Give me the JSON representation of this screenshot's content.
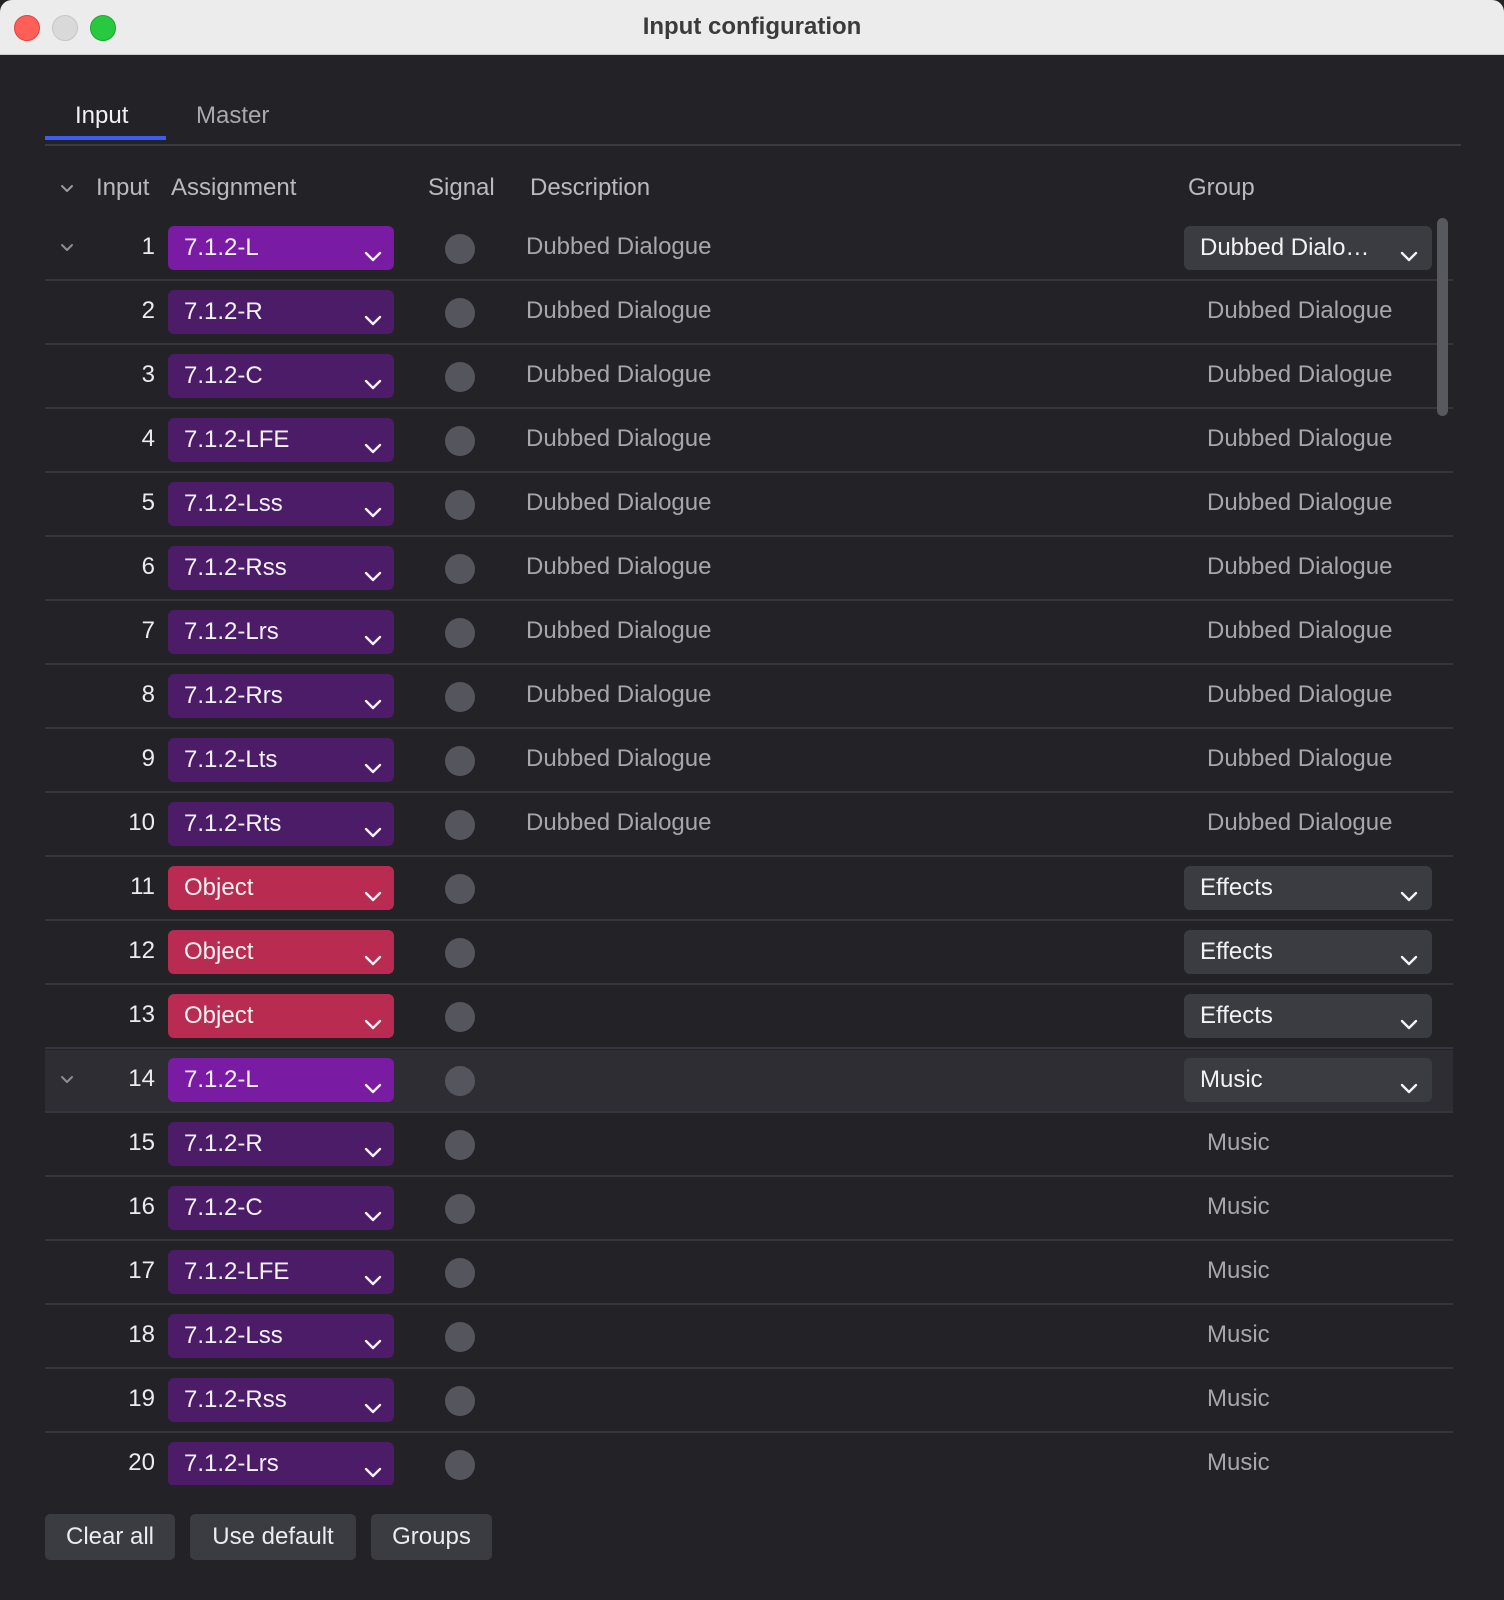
{
  "window": {
    "title": "Input configuration"
  },
  "tabs": {
    "items": [
      {
        "label": "Input",
        "active": true
      },
      {
        "label": "Master",
        "active": false
      }
    ]
  },
  "table": {
    "headers": {
      "input": "Input",
      "assignment": "Assignment",
      "signal": "Signal",
      "description": "Description",
      "group": "Group"
    },
    "rows": [
      {
        "input": "1",
        "assignment": "7.1.2-L",
        "assignment_kind": "bed-first",
        "description": "Dubbed Dialogue",
        "group": "Dubbed Dialo…",
        "group_is_select": true,
        "expandable": true
      },
      {
        "input": "2",
        "assignment": "7.1.2-R",
        "assignment_kind": "bed",
        "description": "Dubbed Dialogue",
        "group": "Dubbed Dialogue",
        "group_is_select": false
      },
      {
        "input": "3",
        "assignment": "7.1.2-C",
        "assignment_kind": "bed",
        "description": "Dubbed Dialogue",
        "group": "Dubbed Dialogue",
        "group_is_select": false
      },
      {
        "input": "4",
        "assignment": "7.1.2-LFE",
        "assignment_kind": "bed",
        "description": "Dubbed Dialogue",
        "group": "Dubbed Dialogue",
        "group_is_select": false
      },
      {
        "input": "5",
        "assignment": "7.1.2-Lss",
        "assignment_kind": "bed",
        "description": "Dubbed Dialogue",
        "group": "Dubbed Dialogue",
        "group_is_select": false
      },
      {
        "input": "6",
        "assignment": "7.1.2-Rss",
        "assignment_kind": "bed",
        "description": "Dubbed Dialogue",
        "group": "Dubbed Dialogue",
        "group_is_select": false
      },
      {
        "input": "7",
        "assignment": "7.1.2-Lrs",
        "assignment_kind": "bed",
        "description": "Dubbed Dialogue",
        "group": "Dubbed Dialogue",
        "group_is_select": false
      },
      {
        "input": "8",
        "assignment": "7.1.2-Rrs",
        "assignment_kind": "bed",
        "description": "Dubbed Dialogue",
        "group": "Dubbed Dialogue",
        "group_is_select": false
      },
      {
        "input": "9",
        "assignment": "7.1.2-Lts",
        "assignment_kind": "bed",
        "description": "Dubbed Dialogue",
        "group": "Dubbed Dialogue",
        "group_is_select": false
      },
      {
        "input": "10",
        "assignment": "7.1.2-Rts",
        "assignment_kind": "bed",
        "description": "Dubbed Dialogue",
        "group": "Dubbed Dialogue",
        "group_is_select": false
      },
      {
        "input": "11",
        "assignment": "Object",
        "assignment_kind": "object",
        "description": "",
        "group": "Effects",
        "group_is_select": true
      },
      {
        "input": "12",
        "assignment": "Object",
        "assignment_kind": "object",
        "description": "",
        "group": "Effects",
        "group_is_select": true
      },
      {
        "input": "13",
        "assignment": "Object",
        "assignment_kind": "object",
        "description": "",
        "group": "Effects",
        "group_is_select": true
      },
      {
        "input": "14",
        "assignment": "7.1.2-L",
        "assignment_kind": "bed-first",
        "description": "",
        "group": "Music",
        "group_is_select": true,
        "expandable": true,
        "selected": true
      },
      {
        "input": "15",
        "assignment": "7.1.2-R",
        "assignment_kind": "bed",
        "description": "",
        "group": "Music",
        "group_is_select": false
      },
      {
        "input": "16",
        "assignment": "7.1.2-C",
        "assignment_kind": "bed",
        "description": "",
        "group": "Music",
        "group_is_select": false
      },
      {
        "input": "17",
        "assignment": "7.1.2-LFE",
        "assignment_kind": "bed",
        "description": "",
        "group": "Music",
        "group_is_select": false
      },
      {
        "input": "18",
        "assignment": "7.1.2-Lss",
        "assignment_kind": "bed",
        "description": "",
        "group": "Music",
        "group_is_select": false
      },
      {
        "input": "19",
        "assignment": "7.1.2-Rss",
        "assignment_kind": "bed",
        "description": "",
        "group": "Music",
        "group_is_select": false
      },
      {
        "input": "20",
        "assignment": "7.1.2-Lrs",
        "assignment_kind": "bed",
        "description": "",
        "group": "Music",
        "group_is_select": false
      }
    ]
  },
  "footer": {
    "clear_all": "Clear all",
    "use_default": "Use default",
    "groups": "Groups"
  },
  "colors": {
    "tab_accent": "#3d5bf5",
    "bed_first": "#7a1ba4",
    "bed": "#4c1c68",
    "object": "#b92b51",
    "signal_idle": "#55555d"
  }
}
